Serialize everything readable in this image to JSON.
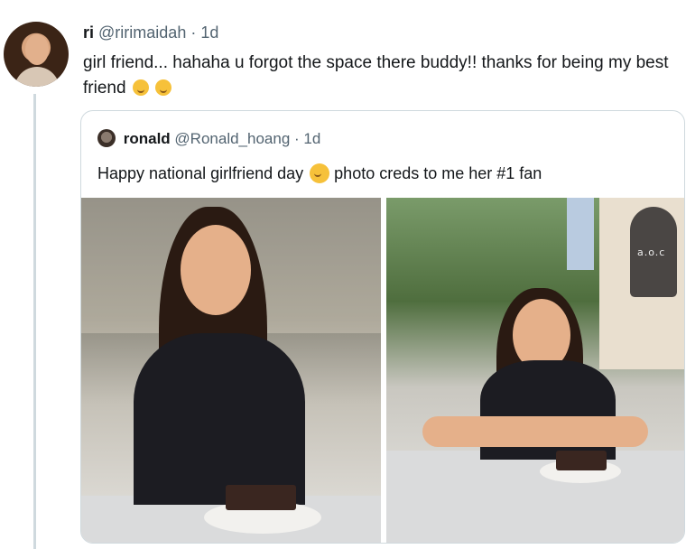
{
  "tweet": {
    "display_name": "ri",
    "handle": "@ririmaidah",
    "separator": "·",
    "time": "1d",
    "text": "girl friend... hahaha u forgot the space there buddy!! thanks for being my best friend"
  },
  "quoted_tweet": {
    "display_name": "ronald",
    "handle": "@Ronald_hoang",
    "separator": "·",
    "time": "1d",
    "text_before_emoji": "Happy national girlfriend day",
    "text_after_emoji": "photo creds to me her #1 fan"
  },
  "photos": {
    "right_bottle_label": "a.o.c"
  },
  "icons": {
    "emoji_1": "upside-down-face-emoji",
    "emoji_2": "relieved-face-emoji",
    "emoji_3": "smiling-face-with-hearts-emoji"
  }
}
